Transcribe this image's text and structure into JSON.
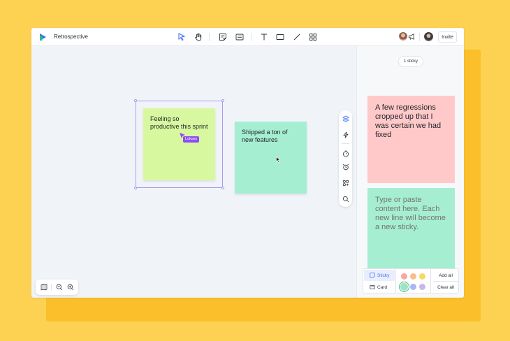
{
  "app": {
    "title": "Retrospective",
    "invite_label": "Invite"
  },
  "panel": {
    "count_label": "1 sticky",
    "preview_sticky_text": "A few regressions cropped up that I was certain we had fixed",
    "input_placeholder": "Type or paste content here. Each new line will become a new sticky.",
    "sticky_tab_label": "Sticky",
    "card_tab_label": "Card",
    "add_all_label": "Add all",
    "clear_all_label": "Clear all"
  },
  "canvas": {
    "stickies": [
      {
        "text": "Feeling so productive this sprint",
        "color": "#D8F8A0"
      },
      {
        "text": "Shipped a ton of new features",
        "color": "#A5EED2"
      }
    ],
    "cursor_label": "Lukasz"
  },
  "colors": {
    "accent": "#3B6CF6",
    "selection": "#A79BF0",
    "cursor": "#8E4CF6",
    "red_sticky": "#FFC9C9",
    "green_sticky": "#A5EED2",
    "palette": [
      "#F7A8A0",
      "#F7C08A",
      "#F6D864",
      "#9DE3C4",
      "#A7B8F3",
      "#C8B6F2"
    ]
  },
  "icons": {
    "toolbar": [
      "select-icon",
      "hand-icon",
      "sticky-note-icon",
      "card-icon",
      "text-icon",
      "rectangle-icon",
      "line-icon",
      "grid-icon"
    ],
    "side": [
      "layers-icon",
      "lightning-icon",
      "timer-icon",
      "alarm-icon",
      "apps-icon",
      "search-icon"
    ],
    "zoom": [
      "map-icon",
      "zoom-out-icon",
      "zoom-in-icon"
    ]
  }
}
